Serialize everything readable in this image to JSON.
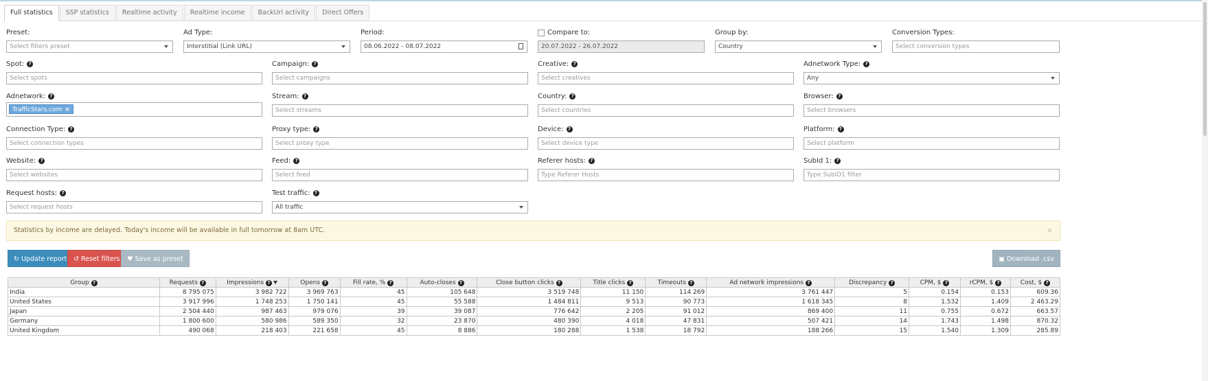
{
  "tabs": [
    "Full statistics",
    "SSP statistics",
    "Realtime activity",
    "Realtime income",
    "BackUrl activity",
    "Direct Offers"
  ],
  "filters": {
    "preset": {
      "label": "Preset:",
      "placeholder": "Select filters preset"
    },
    "ad_type": {
      "label": "Ad Type:",
      "value": "Interstitial (Link URL)"
    },
    "period": {
      "label": "Period:",
      "value": "08.06.2022 - 08.07.2022"
    },
    "compare": {
      "label": "Compare to:",
      "value": "20.07.2022 - 26.07.2022"
    },
    "group_by": {
      "label": "Group by:",
      "value": "Country"
    },
    "conversion_types": {
      "label": "Conversion Types:",
      "placeholder": "Select conversion types"
    },
    "spot": {
      "label": "Spot:",
      "placeholder": "Select spots"
    },
    "campaign": {
      "label": "Campaign:",
      "placeholder": "Select campaigns"
    },
    "creative": {
      "label": "Creative:",
      "placeholder": "Select creatives"
    },
    "adnetwork_type": {
      "label": "Adnetwork Type:",
      "value": "Any"
    },
    "adnetwork": {
      "label": "Adnetwork:",
      "tag": "TrafficStars.com",
      "tag_remove": "×"
    },
    "stream": {
      "label": "Stream:",
      "placeholder": "Select streams"
    },
    "country": {
      "label": "Country:",
      "placeholder": "Select countries"
    },
    "browser": {
      "label": "Browser:",
      "placeholder": "Select browsers"
    },
    "connection_type": {
      "label": "Connection Type:",
      "placeholder": "Select connection types"
    },
    "proxy_type": {
      "label": "Proxy type:",
      "placeholder": "Select proxy type"
    },
    "device": {
      "label": "Device:",
      "placeholder": "Select device type"
    },
    "platform": {
      "label": "Platform:",
      "placeholder": "Select platform"
    },
    "website": {
      "label": "Website:",
      "placeholder": "Select websites"
    },
    "feed": {
      "label": "Feed:",
      "placeholder": "Select feed"
    },
    "referer_hosts": {
      "label": "Referer hosts:",
      "placeholder": "Type Referer Hosts"
    },
    "subid1": {
      "label": "SubId 1:",
      "placeholder": "Type SubID1 filter"
    },
    "request_hosts": {
      "label": "Request hosts:",
      "placeholder": "Select request hosts"
    },
    "test_traffic": {
      "label": "Test traffic:",
      "value": "All traffic"
    }
  },
  "alert": {
    "text": "Statistics by income are delayed. Today's income will be available in full tomorrow at 8am UTC.",
    "close": "×"
  },
  "buttons": {
    "update": "Update report",
    "update_icon": "↻",
    "reset": "Reset filters",
    "reset_icon": "↺",
    "save": "Save as preset",
    "save_icon": "♥",
    "download": "Download .csv",
    "download_icon": "▣"
  },
  "help_glyph": "?",
  "table": {
    "headers": [
      "Group",
      "Requests",
      "Impressions",
      "Opens",
      "Fill rate, %",
      "Auto-closes",
      "Close button clicks",
      "Title clicks",
      "Timeouts",
      "Ad network impressions",
      "Discrepancy",
      "CPM, $",
      "rCPM, $",
      "Cost, $"
    ],
    "rows": [
      [
        "India",
        "8 795 075",
        "3 982 722",
        "3 969 763",
        "45",
        "105 648",
        "3 519 748",
        "11 150",
        "114 269",
        "3 761 447",
        "5",
        "0.154",
        "0.153",
        "609.36"
      ],
      [
        "United States",
        "3 917 996",
        "1 748 253",
        "1 750 141",
        "45",
        "55 588",
        "1 484 811",
        "9 513",
        "90 773",
        "1 618 345",
        "8",
        "1.532",
        "1.409",
        "2 463.29"
      ],
      [
        "Japan",
        "2 504 440",
        "987 463",
        "979 076",
        "39",
        "39 087",
        "776 642",
        "2 205",
        "91 012",
        "869 400",
        "11",
        "0.755",
        "0.672",
        "663.57"
      ],
      [
        "Germany",
        "1 800 600",
        "580 986",
        "589 350",
        "32",
        "23 870",
        "480 390",
        "4 018",
        "47 831",
        "507 421",
        "14",
        "1.743",
        "1.498",
        "870.32"
      ],
      [
        "United Kingdom",
        "490 068",
        "218 403",
        "221 658",
        "45",
        "8 886",
        "180 288",
        "1 538",
        "18 792",
        "188 266",
        "15",
        "1.540",
        "1.309",
        "285.89"
      ]
    ]
  }
}
